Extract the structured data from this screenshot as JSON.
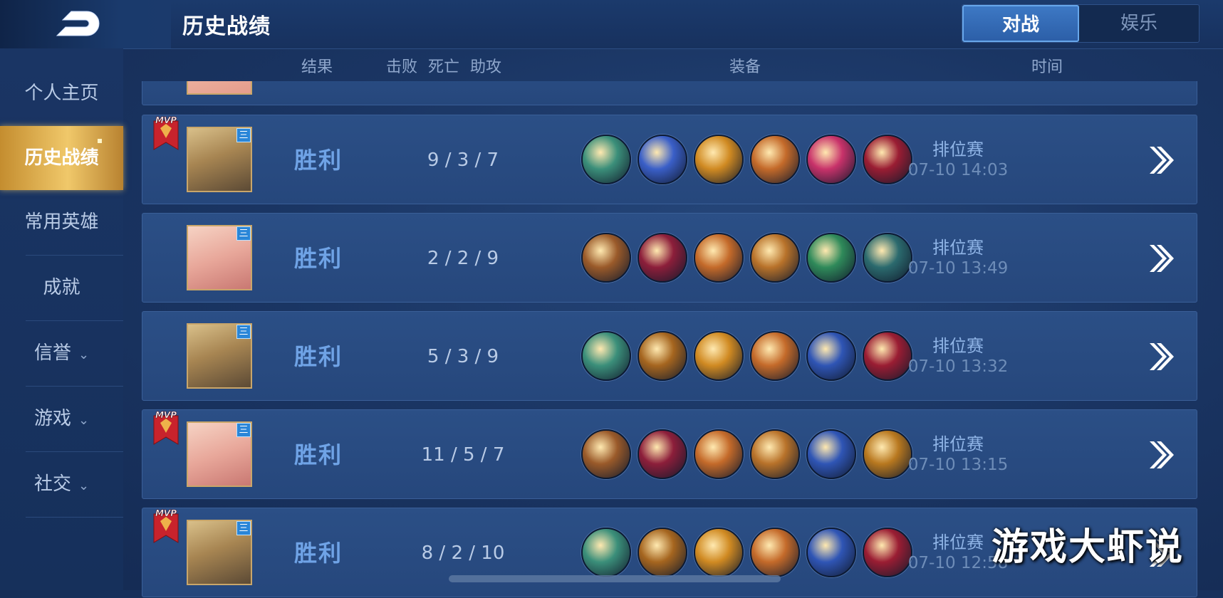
{
  "header": {
    "title": "历史战绩",
    "tabs": [
      {
        "label": "对战",
        "active": true
      },
      {
        "label": "娱乐",
        "active": false
      }
    ]
  },
  "columns": {
    "result": "结果",
    "kills": "击败",
    "deaths": "死亡",
    "assists": "助攻",
    "equipment": "装备",
    "time": "时间"
  },
  "sidebar": {
    "items": [
      {
        "label": "个人主页"
      },
      {
        "label": "历史战绩",
        "active": true
      },
      {
        "label": "常用英雄"
      },
      {
        "label": "成就"
      },
      {
        "label": "信誉",
        "expandable": true
      },
      {
        "label": "游戏",
        "expandable": true
      },
      {
        "label": "社交",
        "expandable": true
      }
    ]
  },
  "matches": [
    {
      "mvp": true,
      "mvp_label": "MVP",
      "tier": "三",
      "result": "胜利",
      "kda": "9 / 3 / 7",
      "mode": "排位赛",
      "time": "07-10  14:03"
    },
    {
      "mvp": false,
      "tier": "三",
      "result": "胜利",
      "kda": "2 / 2 / 9",
      "mode": "排位赛",
      "time": "07-10  13:49"
    },
    {
      "mvp": false,
      "tier": "三",
      "result": "胜利",
      "kda": "5 / 3 / 9",
      "mode": "排位赛",
      "time": "07-10  13:32"
    },
    {
      "mvp": true,
      "mvp_label": "MVP",
      "tier": "三",
      "result": "胜利",
      "kda": "11 / 5 / 7",
      "mode": "排位赛",
      "time": "07-10  13:15"
    },
    {
      "mvp": true,
      "mvp_label": "MVP",
      "tier": "三",
      "result": "胜利",
      "kda": "8 / 2 / 10",
      "mode": "排位赛",
      "time": "07-10  12:58"
    }
  ],
  "watermark": "游戏大虾说",
  "colors": {
    "accent_gold": "#f0c86a",
    "win_blue": "#6fa3e6",
    "panel": "#2b4f86"
  }
}
